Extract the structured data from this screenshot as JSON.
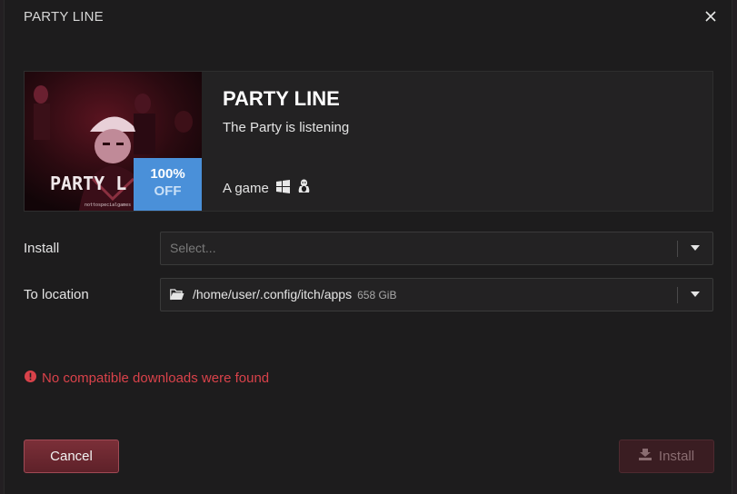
{
  "dialog": {
    "title": "PARTY LINE"
  },
  "game": {
    "title": "PARTY LINE",
    "tagline": "The Party is listening",
    "type": "A game",
    "cover_text": "PARTY L",
    "cover_credit": "nottospecialgames",
    "sale": {
      "percent": "100%",
      "off_label": "OFF"
    },
    "platform_icons": [
      "windows-icon",
      "linux-icon"
    ]
  },
  "form": {
    "install_label": "Install",
    "install_placeholder": "Select...",
    "location_label": "To location",
    "location_path": "/home/user/.config/itch/apps",
    "location_size": "658 GiB"
  },
  "error": {
    "message": "No compatible downloads were found"
  },
  "buttons": {
    "cancel_label": "Cancel",
    "install_label": "Install"
  },
  "colors": {
    "accent": "#4a90d9",
    "error": "#d9424a",
    "cancel_bg": "#6b2831",
    "install_disabled_bg": "#3a1d22"
  }
}
